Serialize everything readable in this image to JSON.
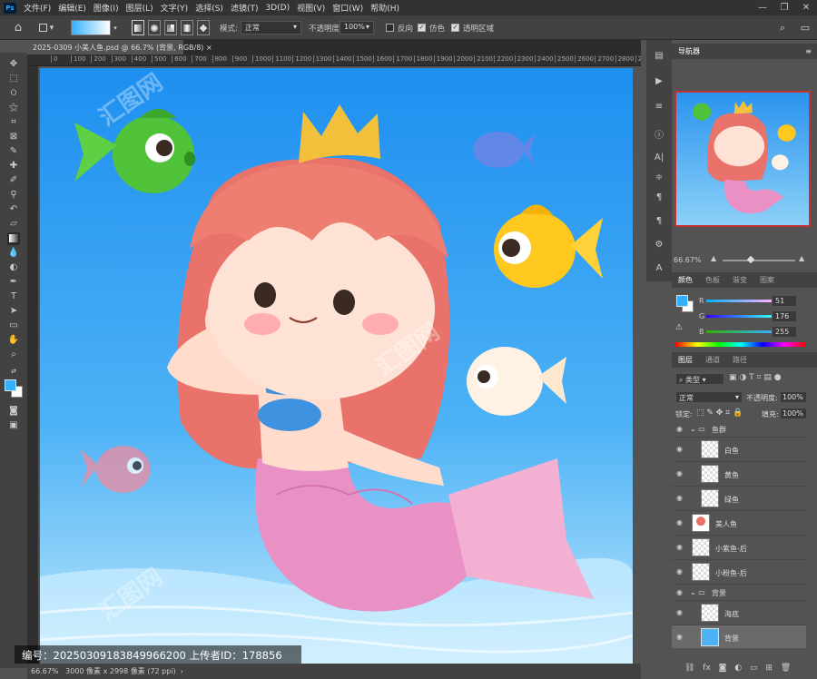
{
  "menu": {
    "logo": "Ps",
    "items": [
      "文件(F)",
      "编辑(E)",
      "图像(I)",
      "图层(L)",
      "文字(Y)",
      "选择(S)",
      "滤镜(T)",
      "3D(D)",
      "视图(V)",
      "窗口(W)",
      "帮助(H)"
    ]
  },
  "options": {
    "mode_label": "模式:",
    "mode_value": "正常",
    "opacity_label": "不透明度:",
    "opacity_value": "100%",
    "reverse_label": "反向",
    "dither_label": "仿色",
    "transparency_label": "透明区域"
  },
  "document": {
    "tab_title": "2025-0309 小美人鱼.psd @ 66.7% (背景, RGB/8)",
    "status_zoom": "66.67%",
    "status_size": "3000 像素 x 2998 像素 (72 ppi)"
  },
  "ruler": {
    "ticks": [
      "0",
      "100",
      "200",
      "300",
      "400",
      "500",
      "600",
      "700",
      "800",
      "900",
      "1000",
      "1100",
      "1200",
      "1300",
      "1400",
      "1500",
      "1600",
      "1700",
      "1800",
      "1900",
      "2000",
      "2100",
      "2200",
      "2300",
      "2400",
      "2500",
      "2600",
      "2700",
      "2800",
      "2900"
    ]
  },
  "watermark": {
    "text": "编号：20250309183849966200    上传者ID：178856",
    "logo_text": "汇图网"
  },
  "navigator": {
    "tab_label": "导航器",
    "zoom_value": "66.67%"
  },
  "color_panel": {
    "tabs": [
      "颜色",
      "色板",
      "渐变",
      "图案"
    ],
    "r_label": "R",
    "r_value": "51",
    "g_label": "G",
    "g_value": "176",
    "b_label": "B",
    "b_value": "255",
    "fg_color": "#33b0ff"
  },
  "layers_panel": {
    "tabs": [
      "图层",
      "通道",
      "路径"
    ],
    "filter_label": "类型",
    "blend_mode": "正常",
    "opacity_label": "不透明度:",
    "opacity_value": "100%",
    "lock_label": "锁定:",
    "fill_label": "填充:",
    "fill_value": "100%",
    "layers": [
      {
        "name": "鱼群",
        "type": "group"
      },
      {
        "name": "白鱼",
        "type": "layer"
      },
      {
        "name": "黄鱼",
        "type": "layer"
      },
      {
        "name": "绿鱼",
        "type": "layer"
      },
      {
        "name": "美人鱼",
        "type": "layer"
      },
      {
        "name": "小紫鱼-后",
        "type": "layer"
      },
      {
        "name": "小粉鱼-后",
        "type": "layer"
      },
      {
        "name": "背景",
        "type": "group"
      },
      {
        "name": "海底",
        "type": "layer"
      },
      {
        "name": "背景",
        "type": "layer",
        "selected": true
      }
    ]
  }
}
